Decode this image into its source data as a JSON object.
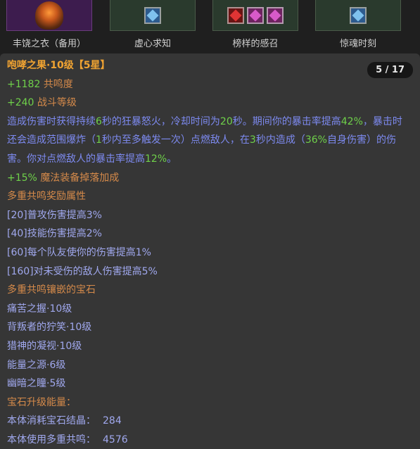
{
  "slots": [
    {
      "label": "丰饶之衣（备用）",
      "icon": "armor-icon"
    },
    {
      "label": "虚心求知",
      "gems": [
        "blue"
      ]
    },
    {
      "label": "榜样的感召",
      "gems": [
        "red",
        "pink",
        "pink"
      ]
    },
    {
      "label": "惊魂时刻",
      "gems": [
        "blue"
      ]
    }
  ],
  "tooltip": {
    "title": "咆哮之果·10级",
    "stars": "【5星】",
    "pager": "5 / 17",
    "stat1": {
      "value": "+1182",
      "label": "共鸣度"
    },
    "stat2": {
      "value": "+240",
      "label": "战斗等级"
    },
    "effect": {
      "p1": "造成伤害时获得持续",
      "n1": "6",
      "p2": "秒的狂暴怒火，冷却时间为",
      "n2": "20",
      "p3": "秒。期间你的暴击率提高",
      "n3": "42%",
      "p4": "，暴击时还会造成范围爆炸（",
      "n4": "1",
      "p5": "秒内至多触发一次）点燃敌人，在",
      "n5": "3",
      "p6": "秒内造成（",
      "n6": "36%",
      "p7": "自身伤害）的伤害。你对点燃敌人的暴击率提高",
      "n7": "12%",
      "p8": "。"
    },
    "stat3": {
      "value": "+15%",
      "label": "魔法装备掉落加成"
    },
    "bonus_header": "多重共鸣奖励属性",
    "bonuses": [
      "[20]普攻伤害提高3%",
      "[40]技能伤害提高2%",
      "[60]每个队友使你的伤害提高1%",
      "[160]对未受伤的敌人伤害提高5%"
    ],
    "socket_header": "多重共鸣镶嵌的宝石",
    "socketed": [
      "痛苦之握·10级",
      "背叛者的狞笑·10级",
      "猎神的凝视·10级",
      "能量之源·6级",
      "幽暗之瞳·5级"
    ],
    "upgrade_header": "宝石升级能量：",
    "consumed_label": "本体消耗宝石结晶：",
    "consumed_value": "284",
    "used_label": "本体使用多重共鸣：",
    "used_value": "4576"
  }
}
